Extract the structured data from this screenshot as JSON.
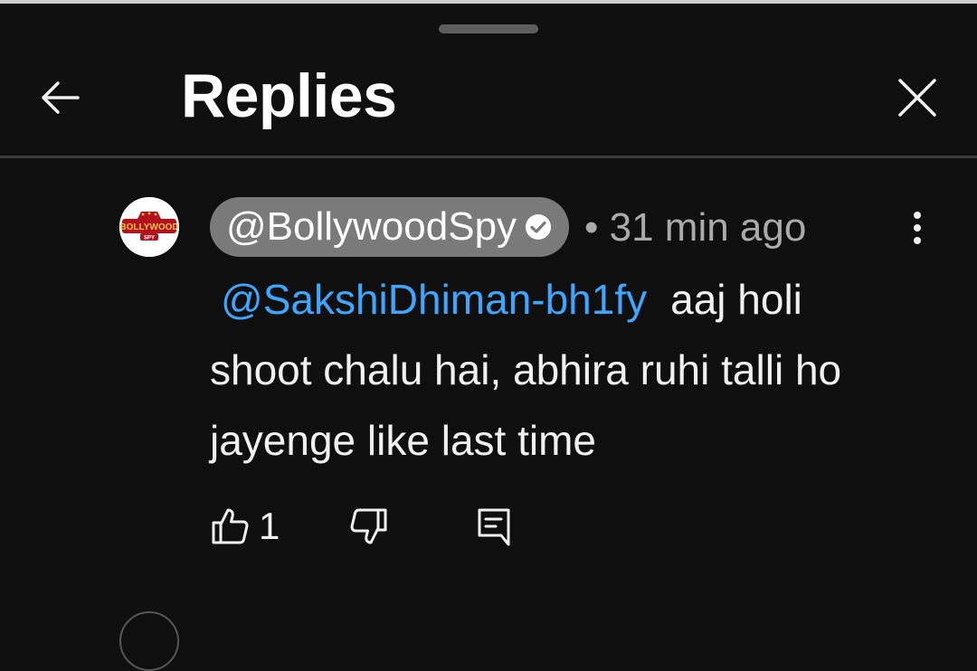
{
  "header": {
    "title": "Replies",
    "back_icon": "arrow-left-icon",
    "close_icon": "close-icon"
  },
  "reply": {
    "avatar": {
      "logo_text": "BOLLYWOOD",
      "logo_sub": "SPY"
    },
    "author": "@BollywoodSpy",
    "verified_icon": "verified-check-icon",
    "separator": "•",
    "time": "31 min ago",
    "mention": "@SakshiDhiman-bh1fy",
    "text": "aaj holi shoot chalu hai, abhira ruhi talli ho jayenge like last time",
    "like_count": "1",
    "more_icon": "more-vert-icon",
    "like_icon": "thumbs-up-icon",
    "dislike_icon": "thumbs-down-icon",
    "reply_icon": "reply-comment-icon"
  },
  "colors": {
    "background": "#0f0f0f",
    "mention": "#3ea6ff",
    "author_chip": "#7a7a7a",
    "meta_text": "#aaaaaa"
  }
}
